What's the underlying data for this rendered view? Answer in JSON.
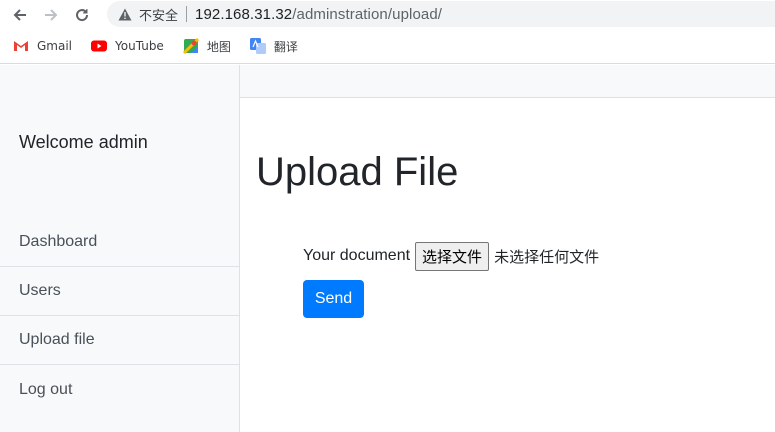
{
  "browser": {
    "security_label": "不安全",
    "url_host": "192.168.31.32",
    "url_path": "/adminstration/upload/",
    "bookmarks": [
      {
        "label": "Gmail",
        "icon": "gmail-icon"
      },
      {
        "label": "YouTube",
        "icon": "youtube-icon"
      },
      {
        "label": "地图",
        "icon": "maps-icon"
      },
      {
        "label": "翻译",
        "icon": "translate-icon"
      }
    ]
  },
  "sidebar": {
    "welcome": "Welcome admin",
    "items": [
      {
        "label": "Dashboard"
      },
      {
        "label": "Users"
      },
      {
        "label": "Upload file"
      },
      {
        "label": "Log out"
      }
    ]
  },
  "main": {
    "title": "Upload File",
    "form": {
      "label": "Your document",
      "file_button": "选择文件",
      "file_status": "未选择任何文件",
      "submit": "Send"
    }
  },
  "colors": {
    "primary": "#007bff",
    "sidebar_bg": "#f8f9fa",
    "border": "#dee2e6",
    "text": "#212529"
  }
}
